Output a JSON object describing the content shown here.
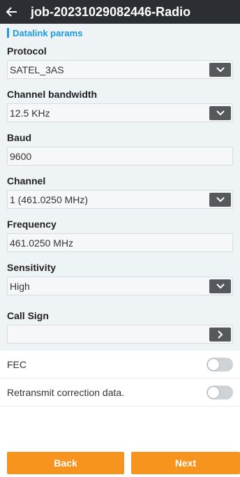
{
  "header": {
    "title": "job-20231029082446-Radio"
  },
  "section": {
    "label": "Datalink params"
  },
  "fields": {
    "protocol": {
      "label": "Protocol",
      "value": "SATEL_3AS"
    },
    "bandwidth": {
      "label": "Channel bandwidth",
      "value": "12.5 KHz"
    },
    "baud": {
      "label": "Baud",
      "value": "9600"
    },
    "channel": {
      "label": "Channel",
      "value": "1 (461.0250 MHz)"
    },
    "frequency": {
      "label": "Frequency",
      "value": "461.0250 MHz"
    },
    "sensitivity": {
      "label": "Sensitivity",
      "value": "High"
    },
    "callsign": {
      "label": "Call Sign",
      "value": ""
    }
  },
  "toggles": {
    "fec": {
      "label": "FEC",
      "on": false
    },
    "retransmit": {
      "label": "Retransmit correction data.",
      "on": false
    }
  },
  "buttons": {
    "back": "Back",
    "next": "Next"
  },
  "icons": {
    "back": "back-arrow-icon",
    "dropdown": "chevron-down-icon",
    "navigate": "chevron-right-icon"
  },
  "colors": {
    "topbar": "#2b2e33",
    "accent": "#1a9be0",
    "button": "#f7941d"
  }
}
